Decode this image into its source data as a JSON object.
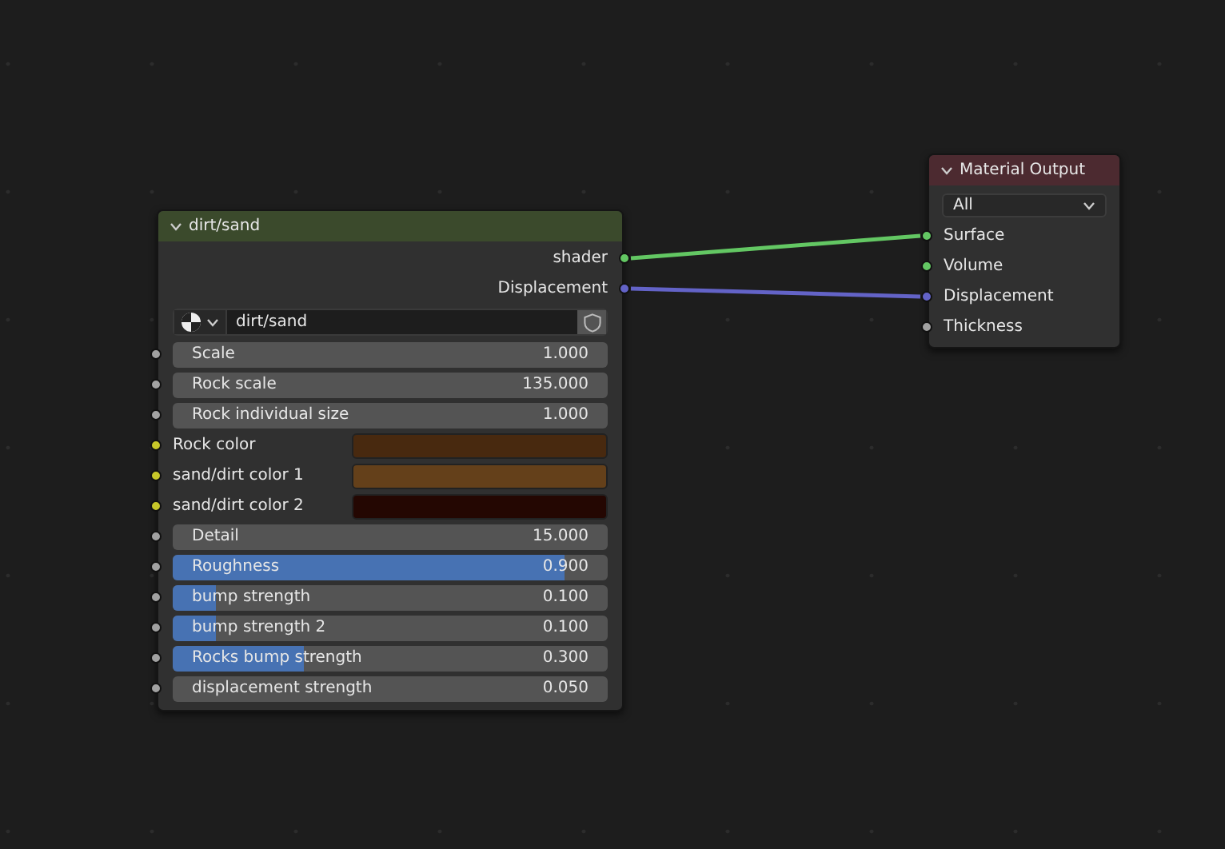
{
  "group_node": {
    "title": "dirt/sand",
    "expanded": true,
    "outputs": [
      {
        "label": "shader",
        "color": "#63c763"
      },
      {
        "label": "Displacement",
        "color": "#6363c7"
      }
    ],
    "datablock": {
      "value": "dirt/sand"
    },
    "inputs": [
      {
        "kind": "number",
        "label": "Scale",
        "value": "1.000"
      },
      {
        "kind": "number",
        "label": "Rock scale",
        "value": "135.000"
      },
      {
        "kind": "number",
        "label": "Rock individual size",
        "value": "1.000"
      },
      {
        "kind": "color",
        "label": "Rock color",
        "color": "#48290f"
      },
      {
        "kind": "color",
        "label": "sand/dirt color 1",
        "color": "#64401a"
      },
      {
        "kind": "color",
        "label": "sand/dirt color 2",
        "color": "#240702"
      },
      {
        "kind": "number",
        "label": "Detail",
        "value": "15.000"
      },
      {
        "kind": "factor",
        "label": "Roughness",
        "value": "0.900",
        "level": 0.9
      },
      {
        "kind": "factor",
        "label": "bump strength",
        "value": "0.100",
        "level": 0.1
      },
      {
        "kind": "factor",
        "label": "bump strength 2",
        "value": "0.100",
        "level": 0.1
      },
      {
        "kind": "factor",
        "label": "Rocks bump strength",
        "value": "0.300",
        "level": 0.3
      },
      {
        "kind": "number",
        "label": "displacement strength",
        "value": "0.050"
      }
    ]
  },
  "output_node": {
    "title": "Material Output",
    "expanded": true,
    "target": "All",
    "inputs": [
      {
        "label": "Surface",
        "color": "#63c763",
        "linked": true
      },
      {
        "label": "Volume",
        "color": "#63c763",
        "linked": false
      },
      {
        "label": "Displacement",
        "color": "#6363c7",
        "linked": true
      },
      {
        "label": "Thickness",
        "color": "#a1a1a1",
        "linked": false
      }
    ]
  }
}
